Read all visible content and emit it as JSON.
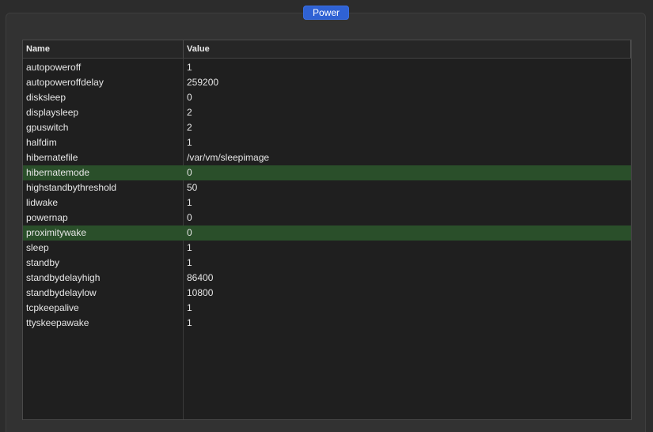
{
  "group": {
    "title": "Power"
  },
  "table": {
    "columns": [
      "Name",
      "Value"
    ],
    "rows": [
      {
        "name": "autopoweroff",
        "value": "1",
        "selected": false
      },
      {
        "name": "autopoweroffdelay",
        "value": "259200",
        "selected": false
      },
      {
        "name": "disksleep",
        "value": "0",
        "selected": false
      },
      {
        "name": "displaysleep",
        "value": "2",
        "selected": false
      },
      {
        "name": "gpuswitch",
        "value": "2",
        "selected": false
      },
      {
        "name": "halfdim",
        "value": "1",
        "selected": false
      },
      {
        "name": "hibernatefile",
        "value": "/var/vm/sleepimage",
        "selected": false
      },
      {
        "name": "hibernatemode",
        "value": "0",
        "selected": true
      },
      {
        "name": "highstandbythreshold",
        "value": "50",
        "selected": false
      },
      {
        "name": "lidwake",
        "value": "1",
        "selected": false
      },
      {
        "name": "powernap",
        "value": "0",
        "selected": false
      },
      {
        "name": "proximitywake",
        "value": "0",
        "selected": true
      },
      {
        "name": "sleep",
        "value": "1",
        "selected": false
      },
      {
        "name": "standby",
        "value": "1",
        "selected": false
      },
      {
        "name": "standbydelayhigh",
        "value": "86400",
        "selected": false
      },
      {
        "name": "standbydelaylow",
        "value": "10800",
        "selected": false
      },
      {
        "name": "tcpkeepalive",
        "value": "1",
        "selected": false
      },
      {
        "name": "ttyskeepawake",
        "value": "1",
        "selected": false
      }
    ]
  },
  "colors": {
    "accent": "#2f62d4",
    "selected_row": "#2a4f2a",
    "background": "#2c2c2c",
    "table_background": "#1f1f1f"
  }
}
